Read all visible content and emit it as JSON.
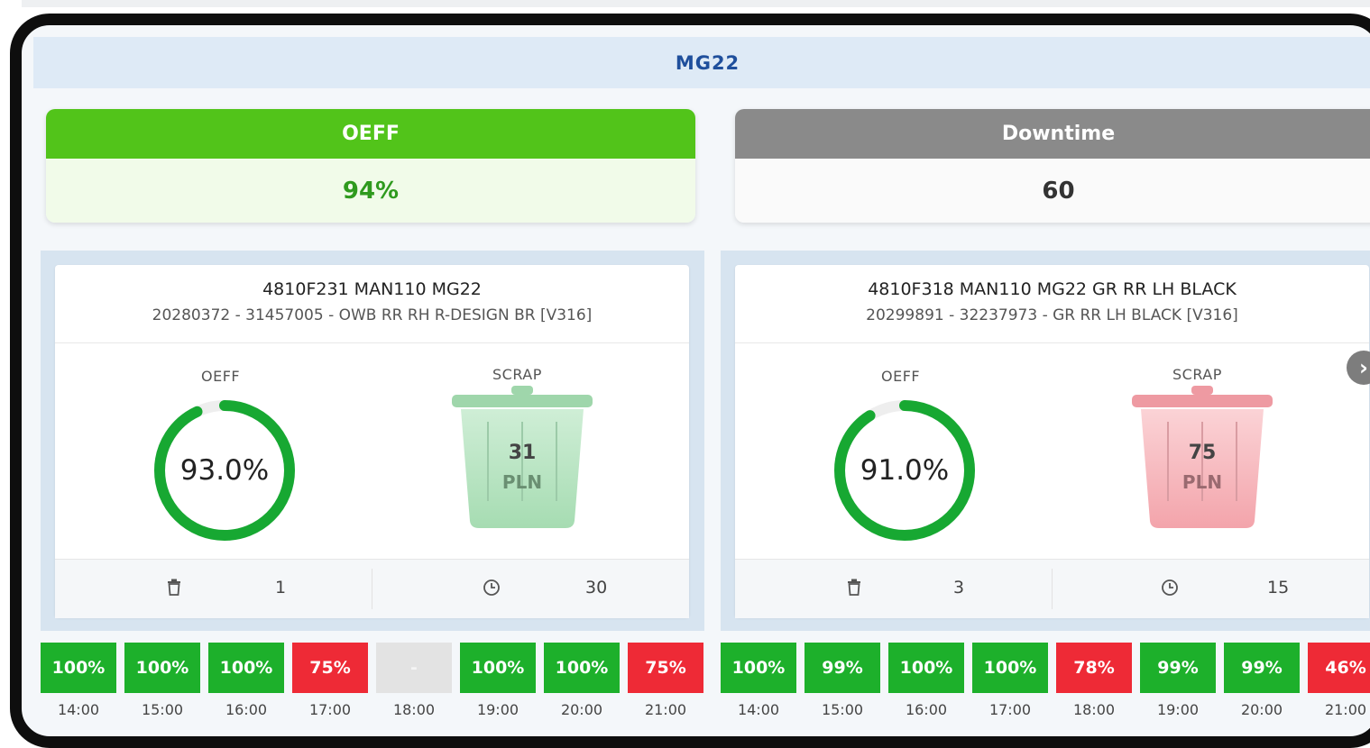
{
  "header": {
    "title": "MG22"
  },
  "kpis": {
    "oeff": {
      "label": "OEFF",
      "value": "94%"
    },
    "downtime": {
      "label": "Downtime",
      "value": "60"
    }
  },
  "machines": [
    {
      "title": "4810F231 MAN110 MG22",
      "subtitle": "20280372 - 31457005 - OWB RR RH R-DESIGN BR [V316]",
      "oeff_label": "OEFF",
      "oeff_value": "93.0%",
      "oeff_fraction": 0.93,
      "scrap_label": "SCRAP",
      "scrap_value": "31",
      "scrap_unit": "PLN",
      "scrap_color": "#8fd19e",
      "scrap_count": "1",
      "downtime_minutes": "30",
      "hours": [
        {
          "pct": "100%",
          "time": "14:00",
          "status": "ok"
        },
        {
          "pct": "100%",
          "time": "15:00",
          "status": "ok"
        },
        {
          "pct": "100%",
          "time": "16:00",
          "status": "ok"
        },
        {
          "pct": "75%",
          "time": "17:00",
          "status": "bad"
        },
        {
          "pct": "-",
          "time": "18:00",
          "status": "none"
        },
        {
          "pct": "100%",
          "time": "19:00",
          "status": "ok"
        },
        {
          "pct": "100%",
          "time": "20:00",
          "status": "ok"
        },
        {
          "pct": "75%",
          "time": "21:00",
          "status": "bad"
        }
      ]
    },
    {
      "title": "4810F318 MAN110 MG22 GR RR LH BLACK",
      "subtitle": "20299891 - 32237973 - GR RR LH BLACK [V316]",
      "oeff_label": "OEFF",
      "oeff_value": "91.0%",
      "oeff_fraction": 0.91,
      "scrap_label": "SCRAP",
      "scrap_value": "75",
      "scrap_unit": "PLN",
      "scrap_color": "#f4a3a8",
      "scrap_count": "3",
      "downtime_minutes": "15",
      "hours": [
        {
          "pct": "100%",
          "time": "14:00",
          "status": "ok"
        },
        {
          "pct": "99%",
          "time": "15:00",
          "status": "ok"
        },
        {
          "pct": "100%",
          "time": "16:00",
          "status": "ok"
        },
        {
          "pct": "100%",
          "time": "17:00",
          "status": "ok"
        },
        {
          "pct": "78%",
          "time": "18:00",
          "status": "bad"
        },
        {
          "pct": "99%",
          "time": "19:00",
          "status": "ok"
        },
        {
          "pct": "99%",
          "time": "20:00",
          "status": "ok"
        },
        {
          "pct": "46%",
          "time": "21:00",
          "status": "bad"
        }
      ]
    }
  ],
  "icons": {
    "scrap_count": "trash-icon",
    "downtime": "clock-icon",
    "next": "chevron-right-icon"
  },
  "colors": {
    "ok": "#1db02b",
    "bad": "#ee2a36",
    "gauge": "#17a832",
    "title": "#1f4f9c"
  }
}
